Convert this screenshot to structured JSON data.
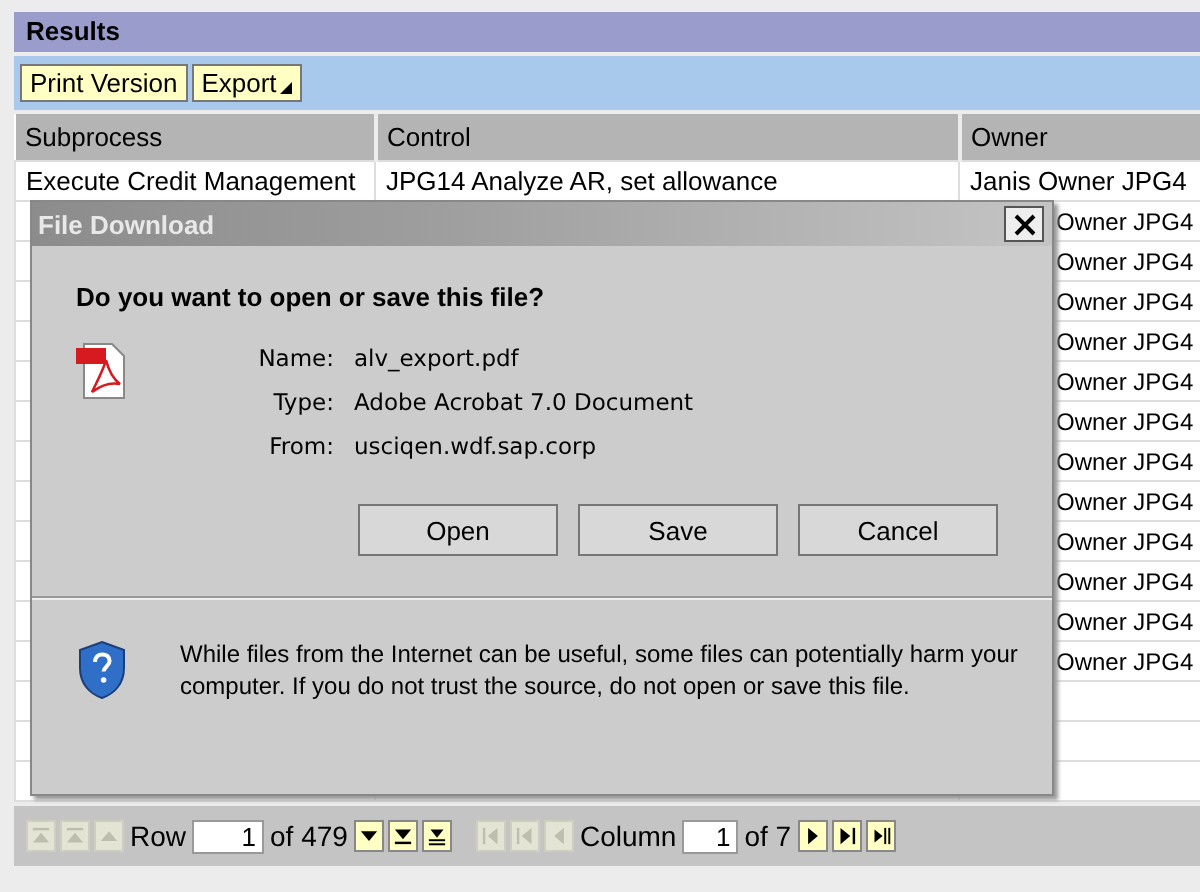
{
  "panel": {
    "title": "Results"
  },
  "toolbar": [
    {
      "label": "Print Version",
      "kind": "button"
    },
    {
      "label": "Export",
      "kind": "menu"
    }
  ],
  "table": {
    "columns": [
      "Subprocess",
      "Control",
      "Owner"
    ],
    "rows": [
      {
        "subprocess": "Execute Credit Management",
        "control": "JPG14 Analyze AR, set allowance",
        "owner": "Janis Owner JPG4"
      },
      {
        "owner": "Owner JPG4"
      },
      {
        "owner": "Owner JPG4"
      },
      {
        "owner": "Owner JPG4"
      },
      {
        "owner": "Owner JPG4"
      },
      {
        "owner": "Owner JPG4"
      },
      {
        "owner": "Owner JPG4"
      },
      {
        "owner": "Owner JPG4"
      },
      {
        "owner": "Owner JPG4"
      },
      {
        "owner": "Owner JPG4"
      },
      {
        "owner": "Owner JPG4"
      },
      {
        "owner": "Owner JPG4"
      },
      {
        "owner": "Owner JPG4"
      }
    ]
  },
  "dialog": {
    "title": "File Download",
    "question": "Do you want to open or save this file?",
    "fields": [
      {
        "label": "Name:",
        "value": "alv_export.pdf"
      },
      {
        "label": "Type:",
        "value": "Adobe Acrobat 7.0 Document"
      },
      {
        "label": "From:",
        "value": "usciqen.wdf.sap.corp"
      }
    ],
    "buttons": [
      "Open",
      "Save",
      "Cancel"
    ],
    "warning": "While files from the Internet can be useful, some files can potentially harm your computer. If you do not trust the source, do not open or save this file."
  },
  "pager": {
    "row": {
      "label": "Row",
      "value": "1",
      "total": "of 479",
      "before": [
        {
          "disabled": true
        },
        {
          "disabled": true
        },
        {
          "disabled": true
        }
      ],
      "after": [
        {
          "disabled": false
        },
        {
          "disabled": false
        },
        {
          "disabled": false
        }
      ]
    },
    "column": {
      "label": "Column",
      "value": "1",
      "total": "of 7",
      "before": [
        {
          "disabled": true
        },
        {
          "disabled": true
        },
        {
          "disabled": true
        }
      ],
      "after": [
        {
          "disabled": false
        },
        {
          "disabled": false
        },
        {
          "disabled": false
        }
      ]
    }
  }
}
